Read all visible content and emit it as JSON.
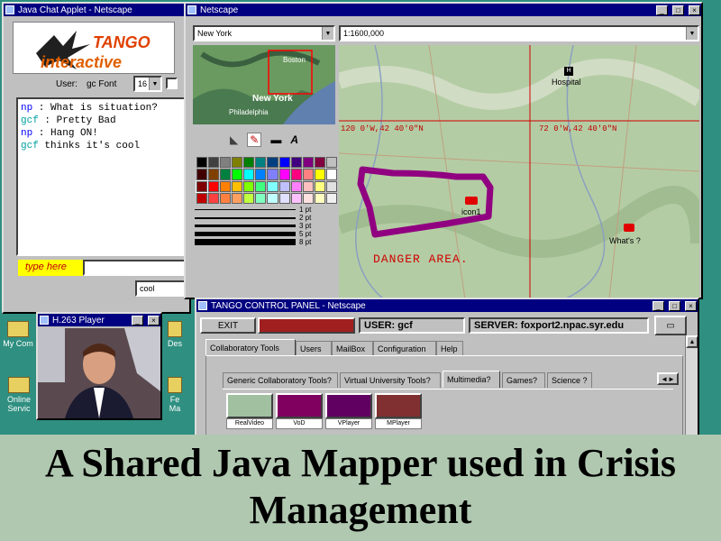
{
  "chat_window": {
    "title": "Java Chat Applet - Netscape",
    "logo_top": "TANGO",
    "logo_bottom": "interactive",
    "user_label": "User:",
    "user_value": "gc Font",
    "font_select": "16",
    "messages": [
      {
        "user": "np",
        "sep": " : ",
        "text": "What is situation?",
        "color": "#0000ff"
      },
      {
        "user": "gcf",
        "sep": " : ",
        "text": "Pretty Bad",
        "color": "#00a0a0"
      },
      {
        "user": "np",
        "sep": " : ",
        "text": "Hang ON!",
        "color": "#0000ff"
      },
      {
        "user": "gcf",
        "sep": " ",
        "text": "thinks it's cool",
        "color": "#00a0a0"
      }
    ],
    "type_here": "type here",
    "cool_select": "cool"
  },
  "netscape_window": {
    "title": "Netscape",
    "location_select": "New York",
    "scale_select": "1:1600,000",
    "overview_labels": [
      "Boston",
      "New York",
      "Philadelphia"
    ],
    "line_widths": [
      "1 pt",
      "2 pt",
      "3 pt",
      "5 pt",
      "8 pt"
    ],
    "palette_colors": [
      "#000000",
      "#404040",
      "#808080",
      "#808000",
      "#008000",
      "#008080",
      "#004080",
      "#0000ff",
      "#400080",
      "#800080",
      "#800040",
      "#c0c0c0",
      "#400000",
      "#804000",
      "#008040",
      "#00ff00",
      "#00ffff",
      "#0080ff",
      "#8080ff",
      "#ff00ff",
      "#ff0080",
      "#ff8080",
      "#ffff00",
      "#ffffff",
      "#800000",
      "#ff0000",
      "#ff8000",
      "#ffc000",
      "#80ff00",
      "#40ff80",
      "#80ffff",
      "#c0c0ff",
      "#ff80ff",
      "#ffc0c0",
      "#ffff80",
      "#e0e0e0",
      "#c00000",
      "#ff4040",
      "#ff8040",
      "#ffa060",
      "#c0ff40",
      "#80ffc0",
      "#c0ffff",
      "#e0e0ff",
      "#ffc0ff",
      "#ffe0e0",
      "#ffffc0",
      "#f0f0f0"
    ],
    "map": {
      "coord_left": "120 0'W,42 40'0\"N",
      "coord_right": "72 0'W,42 40'0\"N",
      "hospital_label": "Hospital",
      "icon1_label": "icon1",
      "whats_label": "What's ?",
      "danger_label": "DANGER AREA."
    }
  },
  "h263_window": {
    "title": "H.263 Player"
  },
  "control_panel": {
    "title": "TANGO CONTROL PANEL - Netscape",
    "exit_label": "EXIT",
    "red_button_label": "",
    "user_text": "USER: gcf",
    "server_text": "SERVER: foxport2.npac.syr.edu",
    "tabs": [
      "Collaboratory Tools",
      "Users",
      "MailBox",
      "Configuration",
      "Help"
    ],
    "subtabs": [
      "Generic Collaboratory Tools?",
      "Virtual University Tools?",
      "Multimedia?",
      "Games?",
      "Science ?"
    ],
    "tools": [
      "RealVideo",
      "VoD",
      "VPlayer",
      "MPlayer"
    ]
  },
  "desktop_icons": [
    "My Com",
    "Online Servic",
    "Des",
    "Fe Ma"
  ],
  "caption": {
    "line1": "A Shared Java Mapper used in Crisis",
    "line2": "Management"
  }
}
